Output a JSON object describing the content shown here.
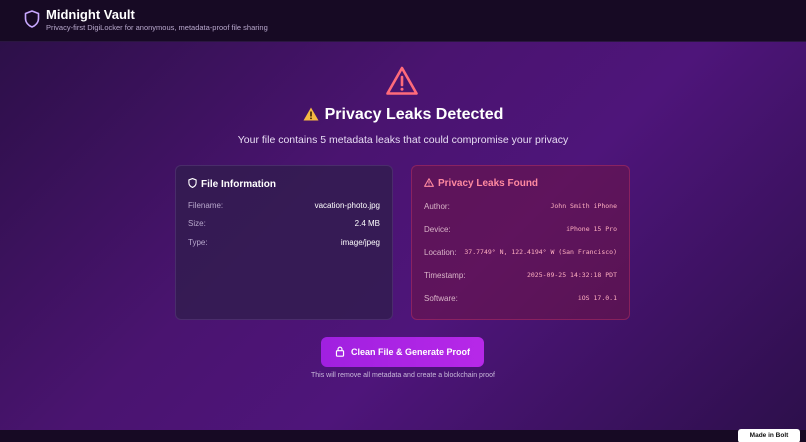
{
  "app": {
    "title": "Midnight Vault",
    "subtitle": "Privacy-first DigiLocker for anonymous, metadata-proof file sharing",
    "logo_icon": "shield-icon"
  },
  "alert": {
    "icon": "warning-triangle-icon",
    "title": "Privacy Leaks Detected",
    "message": "Your file contains 5 metadata leaks that could compromise your privacy"
  },
  "file_info": {
    "title": "File Information",
    "icon": "shield-icon",
    "rows": [
      {
        "key": "Filename:",
        "value": "vacation-photo.jpg"
      },
      {
        "key": "Size:",
        "value": "2.4 MB"
      },
      {
        "key": "Type:",
        "value": "image/jpeg"
      }
    ]
  },
  "leaks": {
    "title": "Privacy Leaks Found",
    "icon": "warning-triangle-icon",
    "rows": [
      {
        "key": "Author:",
        "value": "John Smith iPhone"
      },
      {
        "key": "Device:",
        "value": "iPhone 15 Pro"
      },
      {
        "key": "Location:",
        "value": "37.7749° N, 122.4194° W (San Francisco)"
      },
      {
        "key": "Timestamp:",
        "value": "2025-09-25 14:32:18 PDT"
      },
      {
        "key": "Software:",
        "value": "iOS 17.0.1"
      }
    ]
  },
  "action": {
    "button_label": "Clean File & Generate Proof",
    "button_icon": "lock-icon",
    "note": "This will remove all metadata and create a blockchain proof"
  },
  "badge": {
    "label": "Made in Bolt"
  },
  "colors": {
    "accent": "#a020e0",
    "warning": "#ff6b7a",
    "amber": "#f5b942"
  }
}
